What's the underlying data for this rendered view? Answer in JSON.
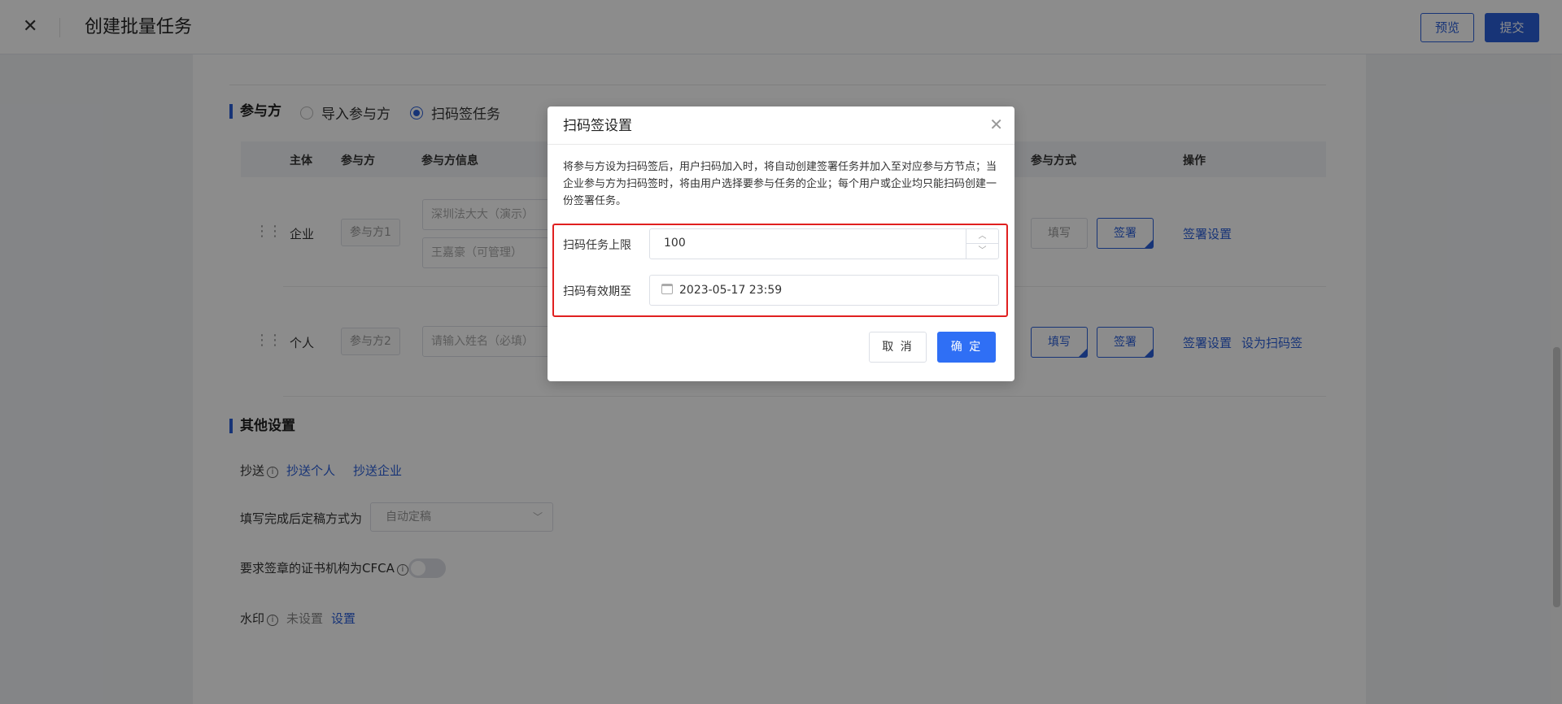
{
  "header": {
    "close_glyph": "✕",
    "title": "创建批量任务",
    "preview_label": "预览",
    "submit_label": "提交"
  },
  "participants": {
    "section_title": "参与方",
    "radio_options": [
      {
        "label": "导入参与方",
        "selected": false
      },
      {
        "label": "扫码签任务",
        "selected": true
      }
    ],
    "columns": {
      "subject": "主体",
      "party": "参与方",
      "party_info": "参与方信息",
      "mode": "参与方式",
      "action": "操作"
    },
    "rows": [
      {
        "subject": "企业",
        "party": "参与方1",
        "info_line1": "深圳法大大（演示）网",
        "info_line2": "王嘉豪（可管理）",
        "mode_fill": "填写",
        "mode_sign": "签署",
        "action1": "签署设置",
        "action2": ""
      },
      {
        "subject": "个人",
        "party": "参与方2",
        "info_placeholder": "请输入姓名（必填）",
        "mode_fill": "填写",
        "mode_sign": "签署",
        "action1": "签署设置",
        "action2": "设为扫码签"
      }
    ]
  },
  "other_settings": {
    "section_title": "其他设置",
    "cc_label": "抄送",
    "cc_person": "抄送个人",
    "cc_company": "抄送企业",
    "finalize_label": "填写完成后定稿方式为",
    "finalize_value": "自动定稿",
    "cfca_label": "要求签章的证书机构为CFCA",
    "cfca_enabled": false,
    "watermark_label": "水印",
    "watermark_status": "未设置",
    "watermark_link": "设置"
  },
  "modal": {
    "title": "扫码签设置",
    "close_glyph": "✕",
    "description": "将参与方设为扫码签后，用户扫码加入时，将自动创建签署任务并加入至对应参与方节点；当企业参与方为扫码签时，将由用户选择要参与任务的企业；每个用户或企业均只能扫码创建一份签署任务。",
    "limit_label": "扫码任务上限",
    "limit_value": "100",
    "expiry_label": "扫码有效期至",
    "expiry_value": "2023-05-17 23:59",
    "cancel_label": "取 消",
    "confirm_label": "确 定",
    "highlight_color": "#e02020"
  },
  "colors": {
    "primary": "#2b5fd9",
    "confirm": "#2f6ff5"
  }
}
